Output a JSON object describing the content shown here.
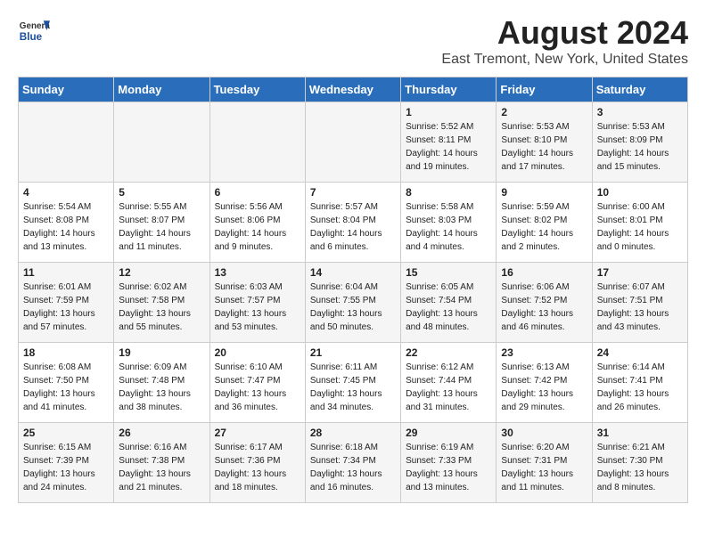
{
  "header": {
    "logo_general": "General",
    "logo_blue": "Blue",
    "title": "August 2024",
    "subtitle": "East Tremont, New York, United States"
  },
  "weekdays": [
    "Sunday",
    "Monday",
    "Tuesday",
    "Wednesday",
    "Thursday",
    "Friday",
    "Saturday"
  ],
  "weeks": [
    [
      {
        "day": "",
        "info": ""
      },
      {
        "day": "",
        "info": ""
      },
      {
        "day": "",
        "info": ""
      },
      {
        "day": "",
        "info": ""
      },
      {
        "day": "1",
        "info": "Sunrise: 5:52 AM\nSunset: 8:11 PM\nDaylight: 14 hours\nand 19 minutes."
      },
      {
        "day": "2",
        "info": "Sunrise: 5:53 AM\nSunset: 8:10 PM\nDaylight: 14 hours\nand 17 minutes."
      },
      {
        "day": "3",
        "info": "Sunrise: 5:53 AM\nSunset: 8:09 PM\nDaylight: 14 hours\nand 15 minutes."
      }
    ],
    [
      {
        "day": "4",
        "info": "Sunrise: 5:54 AM\nSunset: 8:08 PM\nDaylight: 14 hours\nand 13 minutes."
      },
      {
        "day": "5",
        "info": "Sunrise: 5:55 AM\nSunset: 8:07 PM\nDaylight: 14 hours\nand 11 minutes."
      },
      {
        "day": "6",
        "info": "Sunrise: 5:56 AM\nSunset: 8:06 PM\nDaylight: 14 hours\nand 9 minutes."
      },
      {
        "day": "7",
        "info": "Sunrise: 5:57 AM\nSunset: 8:04 PM\nDaylight: 14 hours\nand 6 minutes."
      },
      {
        "day": "8",
        "info": "Sunrise: 5:58 AM\nSunset: 8:03 PM\nDaylight: 14 hours\nand 4 minutes."
      },
      {
        "day": "9",
        "info": "Sunrise: 5:59 AM\nSunset: 8:02 PM\nDaylight: 14 hours\nand 2 minutes."
      },
      {
        "day": "10",
        "info": "Sunrise: 6:00 AM\nSunset: 8:01 PM\nDaylight: 14 hours\nand 0 minutes."
      }
    ],
    [
      {
        "day": "11",
        "info": "Sunrise: 6:01 AM\nSunset: 7:59 PM\nDaylight: 13 hours\nand 57 minutes."
      },
      {
        "day": "12",
        "info": "Sunrise: 6:02 AM\nSunset: 7:58 PM\nDaylight: 13 hours\nand 55 minutes."
      },
      {
        "day": "13",
        "info": "Sunrise: 6:03 AM\nSunset: 7:57 PM\nDaylight: 13 hours\nand 53 minutes."
      },
      {
        "day": "14",
        "info": "Sunrise: 6:04 AM\nSunset: 7:55 PM\nDaylight: 13 hours\nand 50 minutes."
      },
      {
        "day": "15",
        "info": "Sunrise: 6:05 AM\nSunset: 7:54 PM\nDaylight: 13 hours\nand 48 minutes."
      },
      {
        "day": "16",
        "info": "Sunrise: 6:06 AM\nSunset: 7:52 PM\nDaylight: 13 hours\nand 46 minutes."
      },
      {
        "day": "17",
        "info": "Sunrise: 6:07 AM\nSunset: 7:51 PM\nDaylight: 13 hours\nand 43 minutes."
      }
    ],
    [
      {
        "day": "18",
        "info": "Sunrise: 6:08 AM\nSunset: 7:50 PM\nDaylight: 13 hours\nand 41 minutes."
      },
      {
        "day": "19",
        "info": "Sunrise: 6:09 AM\nSunset: 7:48 PM\nDaylight: 13 hours\nand 38 minutes."
      },
      {
        "day": "20",
        "info": "Sunrise: 6:10 AM\nSunset: 7:47 PM\nDaylight: 13 hours\nand 36 minutes."
      },
      {
        "day": "21",
        "info": "Sunrise: 6:11 AM\nSunset: 7:45 PM\nDaylight: 13 hours\nand 34 minutes."
      },
      {
        "day": "22",
        "info": "Sunrise: 6:12 AM\nSunset: 7:44 PM\nDaylight: 13 hours\nand 31 minutes."
      },
      {
        "day": "23",
        "info": "Sunrise: 6:13 AM\nSunset: 7:42 PM\nDaylight: 13 hours\nand 29 minutes."
      },
      {
        "day": "24",
        "info": "Sunrise: 6:14 AM\nSunset: 7:41 PM\nDaylight: 13 hours\nand 26 minutes."
      }
    ],
    [
      {
        "day": "25",
        "info": "Sunrise: 6:15 AM\nSunset: 7:39 PM\nDaylight: 13 hours\nand 24 minutes."
      },
      {
        "day": "26",
        "info": "Sunrise: 6:16 AM\nSunset: 7:38 PM\nDaylight: 13 hours\nand 21 minutes."
      },
      {
        "day": "27",
        "info": "Sunrise: 6:17 AM\nSunset: 7:36 PM\nDaylight: 13 hours\nand 18 minutes."
      },
      {
        "day": "28",
        "info": "Sunrise: 6:18 AM\nSunset: 7:34 PM\nDaylight: 13 hours\nand 16 minutes."
      },
      {
        "day": "29",
        "info": "Sunrise: 6:19 AM\nSunset: 7:33 PM\nDaylight: 13 hours\nand 13 minutes."
      },
      {
        "day": "30",
        "info": "Sunrise: 6:20 AM\nSunset: 7:31 PM\nDaylight: 13 hours\nand 11 minutes."
      },
      {
        "day": "31",
        "info": "Sunrise: 6:21 AM\nSunset: 7:30 PM\nDaylight: 13 hours\nand 8 minutes."
      }
    ]
  ]
}
